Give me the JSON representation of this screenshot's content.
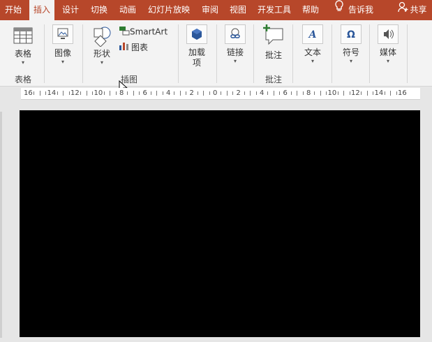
{
  "tabs": [
    "开始",
    "插入",
    "设计",
    "切换",
    "动画",
    "幻灯片放映",
    "审阅",
    "视图",
    "开发工具",
    "帮助"
  ],
  "tell_me": "告诉我",
  "share": "共享",
  "ribbon": {
    "table": {
      "label": "表格",
      "group": "表格"
    },
    "image": {
      "label": "图像"
    },
    "shapes": {
      "label": "形状"
    },
    "smartart": {
      "label": "SmartArt"
    },
    "chart": {
      "label": "图表"
    },
    "illustrations_group": "插图",
    "addins": {
      "label_line1": "加载",
      "label_line2": "项"
    },
    "link": {
      "label": "链接"
    },
    "comment": {
      "label": "批注",
      "group": "批注"
    },
    "text": {
      "label": "文本"
    },
    "symbols": {
      "label": "符号"
    },
    "media": {
      "label": "媒体"
    }
  },
  "ruler": [
    "16",
    "14",
    "12",
    "10",
    "8",
    "6",
    "4",
    "2",
    "0",
    "2",
    "4",
    "6",
    "8",
    "10",
    "12",
    "14",
    "16"
  ],
  "colors": {
    "accent": "#b7472a",
    "ribbon": "#f3f3f3",
    "slide": "#000000"
  }
}
